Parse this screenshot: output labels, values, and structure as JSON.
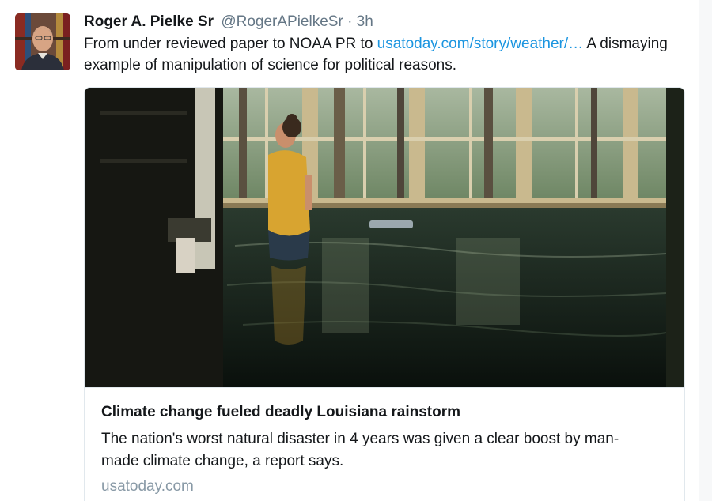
{
  "tweet": {
    "author_name": "Roger A. Pielke Sr",
    "author_handle": "@RogerAPielkeSr",
    "separator": "·",
    "time": "3h",
    "text_before_link": "From under reviewed paper to NOAA PR to ",
    "link_text": "usatoday.com/story/weather/…",
    "text_after_link": "  A dismaying example of manipulation of science for political reasons."
  },
  "card": {
    "title": "Climate change fueled deadly Louisiana rainstorm",
    "description": "The nation's worst natural disaster in 4 years was given a clear boost by man-made climate change, a report says.",
    "domain": "usatoday.com"
  },
  "colors": {
    "link": "#1b95e0",
    "muted": "#657786",
    "text": "#14171a",
    "border": "#e1e8ed"
  }
}
